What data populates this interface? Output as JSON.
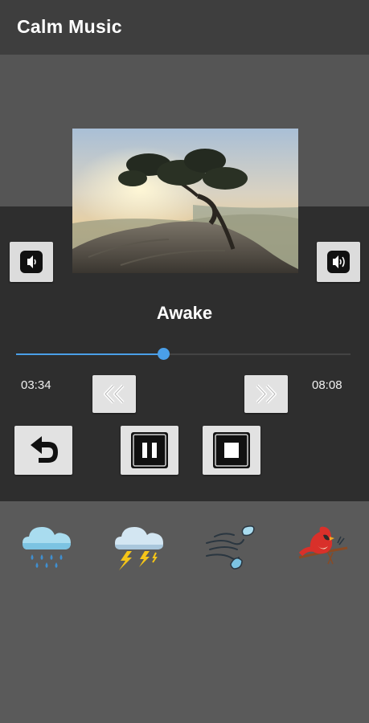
{
  "app": {
    "title": "Calm Music"
  },
  "player": {
    "track_title": "Awake",
    "current_time": "03:34",
    "total_time": "08:08",
    "progress": 0.44
  },
  "colors": {
    "accent": "#4a9fe8",
    "panel": "#2e2e2e",
    "appbar": "#3e3e3e",
    "button": "#e2e2e2"
  },
  "icons": {
    "volume_down": "speaker-low-icon",
    "volume_up": "speaker-high-icon",
    "rewind": "rewind-icon",
    "forward": "fast-forward-icon",
    "repeat": "repeat-icon",
    "pause": "pause-icon",
    "stop": "stop-icon"
  },
  "sounds": [
    {
      "icon": "rain-cloud-icon"
    },
    {
      "icon": "thunderstorm-icon"
    },
    {
      "icon": "wind-icon"
    },
    {
      "icon": "bird-icon"
    }
  ]
}
